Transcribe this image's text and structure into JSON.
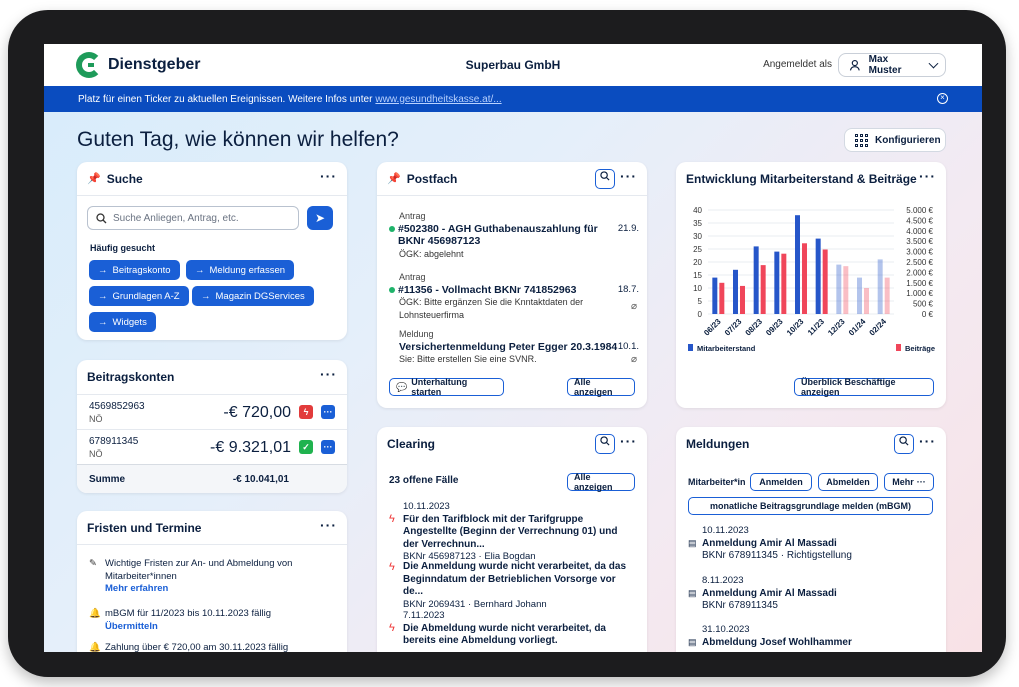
{
  "header": {
    "logo_text": "Dienstgeber",
    "company": "Superbau GmbH",
    "logged_in_label": "Angemeldet als",
    "user_name": "Max Muster"
  },
  "ticker": {
    "text": "Platz für einen Ticker zu aktuellen Ereignissen. Weitere Infos unter",
    "link": "www.gesundheitskasse.at/..."
  },
  "greeting": "Guten Tag, wie können wir helfen?",
  "config_label": "Konfigurieren",
  "search": {
    "title": "Suche",
    "placeholder": "Suche Anliegen, Antrag, etc.",
    "frequent_label": "Häufig gesucht",
    "chips": [
      "Beitragskonto",
      "Meldung erfassen",
      "Grundlagen A-Z",
      "Magazin DGServices",
      "Widgets"
    ]
  },
  "accounts": {
    "title": "Beitragskonten",
    "items": [
      {
        "number": "4569852963",
        "region": "NÖ",
        "amount": "-€ 720,00",
        "status_color": "#e23b3b"
      },
      {
        "number": "678911345",
        "region": "NÖ",
        "amount": "-€ 9.321,01",
        "status_color": "#20b34f"
      }
    ],
    "sum_label": "Summe",
    "sum_value": "-€ 10.041,01"
  },
  "deadlines": {
    "title": "Fristen und Termine",
    "items": [
      {
        "text": "Wichtige Fristen zur An- und Abmeldung von Mitarbeiter*innen",
        "link": "Mehr erfahren"
      },
      {
        "text": "mBGM für 11/2023 bis 10.11.2023 fällig",
        "link": "Übermitteln"
      },
      {
        "text": "Zahlung über € 720,00 am 30.11.2023 fällig",
        "link": ""
      }
    ]
  },
  "postfach": {
    "title": "Postfach",
    "items": [
      {
        "type": "Antrag",
        "title": "#502380 - AGH Guthabenauszahlung für BKNr 456987123",
        "sub": "ÖGK: abgelehnt",
        "date": "21.9."
      },
      {
        "type": "Antrag",
        "title": "#11356 - Vollmacht BKNr 741852963",
        "sub": "ÖGK: Bitte ergänzen Sie die Knntaktdaten der Lohnsteuerfirma",
        "date": "18.7."
      },
      {
        "type": "Meldung",
        "title": "Versichertenmeldung Peter Egger 20.3.1984",
        "sub": "Sie: Bitte erstellen Sie eine SVNR.",
        "date": "10.1."
      }
    ],
    "start_chat": "Unterhaltung starten",
    "show_all": "Alle anzeigen"
  },
  "clearing": {
    "title": "Clearing",
    "open_cases": "23 offene Fälle",
    "show_all": "Alle anzeigen",
    "items": [
      {
        "date": "10.11.2023",
        "text": "Für den Tarifblock mit der Tarifgruppe Angestellte (Beginn der Verrechnung 01) und der Verrechnun...",
        "meta": "BKNr 456987123 · Elia Bogdan"
      },
      {
        "date": "",
        "text": "Die Anmeldung wurde nicht verarbeitet, da das Beginndatum der Betrieblichen Vorsorge vor de...",
        "meta": "BKNr 2069431 · Bernhard Johann"
      },
      {
        "date": "7.11.2023",
        "text": "Die Abmeldung wurde nicht verarbeitet, da bereits eine Abmeldung vorliegt.",
        "meta": ""
      }
    ]
  },
  "chart_card": {
    "title": "Entwicklung Mitarbeiterstand & Beiträge",
    "button": "Überblick Beschäftige anzeigen"
  },
  "chart_data": {
    "type": "bar",
    "categories": [
      "06/23",
      "07/23",
      "08/23",
      "09/23",
      "10/23",
      "11/23",
      "12/23",
      "01/24",
      "02/24"
    ],
    "series": [
      {
        "name": "Mitarbeiterstand",
        "values": [
          14,
          17,
          26,
          24,
          38,
          29,
          19,
          14,
          21
        ],
        "color": "#2656c9"
      },
      {
        "name": "Beiträge",
        "values": [
          1500,
          1350,
          2350,
          2900,
          3400,
          3100,
          2300,
          1250,
          1750
        ],
        "color": "#f0465a"
      }
    ],
    "projected_from_index": 6,
    "ylim_left": [
      0,
      40
    ],
    "ylim_right": [
      0,
      5000
    ],
    "yticks_left": [
      "40",
      "35",
      "30",
      "25",
      "20",
      "15",
      "10",
      "5",
      "0"
    ],
    "yticks_right": [
      "5.000 €",
      "4.500 €",
      "4.000 €",
      "3.500 €",
      "3.000 €",
      "2.500 €",
      "2.000 €",
      "1.500 €",
      "1.000 €",
      "500 €",
      "0 €"
    ],
    "grid": true
  },
  "meldungen": {
    "title": "Meldungen",
    "role_label": "Mitarbeiter*in",
    "buttons": [
      "Anmelden",
      "Abmelden",
      "Mehr"
    ],
    "wide_button": "monatliche Beitragsgrundlage melden (mBGM)",
    "items": [
      {
        "date": "10.11.2023",
        "title": "Anmeldung Amir Al Massadi",
        "sub": "BKNr 678911345 · Richtigstellung"
      },
      {
        "date": "8.11.2023",
        "title": "Anmeldung Amir Al Massadi",
        "sub": "BKNr 678911345"
      },
      {
        "date": "31.10.2023",
        "title": "Abmeldung Josef Wohlhammer",
        "sub": ""
      }
    ]
  }
}
